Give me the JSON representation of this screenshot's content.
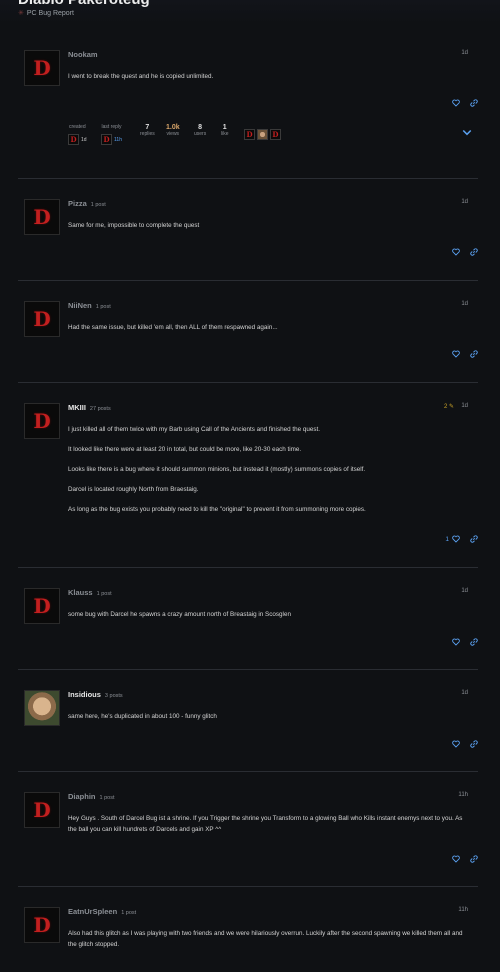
{
  "topic": {
    "title": "Diablo Pakeroteug",
    "category": "PC Bug Report",
    "category_color": "#7a3b3b"
  },
  "colors": {
    "background": "#0f1114",
    "accent_blue": "#5aa0f0",
    "divider": "#2a2d33",
    "logo_red": "#c21f1f"
  },
  "icons": {
    "like": "heart-icon",
    "share": "link-icon",
    "expand": "chevron-down-icon",
    "edit": "pencil-icon",
    "avatar": "diablo-d-logo"
  },
  "topic_map": {
    "created_label": "created",
    "created_time": "1d",
    "last_reply_label": "last reply",
    "last_reply_time": "11h",
    "replies": "7",
    "replies_label": "replies",
    "views": "1.0k",
    "views_label": "views",
    "users": "8",
    "users_label": "users",
    "likes": "1",
    "likes_label": "like"
  },
  "posts": [
    {
      "username": "Nookam",
      "post_count": "",
      "date": "1d",
      "body": [
        "I went to break the quest and he is copied unlimited."
      ]
    },
    {
      "username": "Pizza",
      "post_count": "1 post",
      "date": "1d",
      "body": [
        "Same for me, impossible to complete the quest"
      ]
    },
    {
      "username": "NiiNen",
      "post_count": "1 post",
      "date": "1d",
      "body": [
        "Had the same issue, but killed 'em all, then ALL of them respawned again..."
      ]
    },
    {
      "username": "MKIII",
      "post_count": "27 posts",
      "date": "1d",
      "edits": "2",
      "likes": "1",
      "body": [
        "I just killed all of them twice with my Barb using Call of the Ancients and finished the quest.",
        "It looked like there were at least 20 in total, but could be more, like 20-30 each time.",
        "Looks like there is a bug where it should summon minions, but instead it (mostly) summons copies of itself.",
        "Darcel is located roughly North from Braestaig.",
        "As long as the bug exists you probably need to kill the \"original\" to prevent it from summoning more copies."
      ]
    },
    {
      "username": "Klauss",
      "post_count": "1 post",
      "date": "1d",
      "body": [
        "some bug with Darcel he spawns a crazy amount north of Breastaig in Scosglen"
      ]
    },
    {
      "username": "Insidious",
      "post_count": "3 posts",
      "date": "1d",
      "body": [
        "same here, he's duplicated in about 100 - funny glitch"
      ]
    },
    {
      "username": "Diaphin",
      "post_count": "1 post",
      "date": "11h",
      "body": [
        "Hey Guys . South of Darcel Bug ist a shrine. If you Trigger the shrine you Transform to a glowing Ball who Kills instant enemys next to you. As the ball you can kill hundrets of Darcels and gain XP ^^"
      ]
    },
    {
      "username": "EatnUrSpleen",
      "post_count": "1 post",
      "date": "11h",
      "body": [
        "Also had this glitch as I was playing with two friends and we were hilariously overrun. Luckily after the second spawning we killed them all and the glitch stopped."
      ]
    }
  ]
}
